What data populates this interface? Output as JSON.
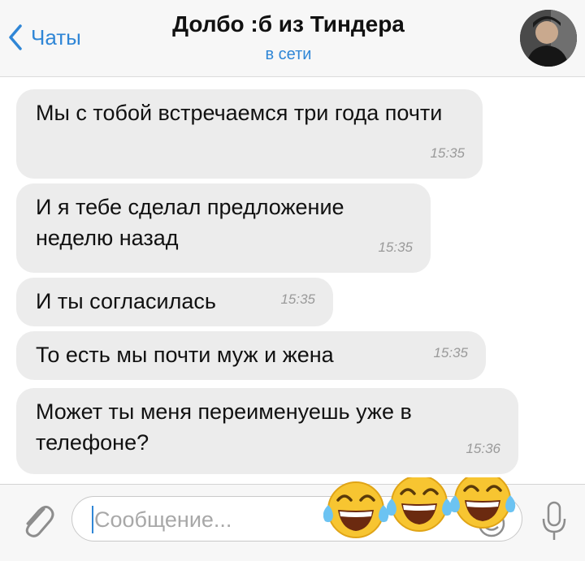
{
  "header": {
    "back_label": "Чаты",
    "title": "Долбо :б из Тиндера",
    "status": "в сети"
  },
  "messages": [
    {
      "text": "Мы с тобой встречаемся три года почти",
      "time": "15:35"
    },
    {
      "text": "И я тебе сделал предложение неделю назад",
      "time": "15:35"
    },
    {
      "text": "И ты согласилась",
      "time": "15:35"
    },
    {
      "text": "То есть мы почти муж и жена",
      "time": "15:35"
    },
    {
      "text": "Может ты меня переименуешь уже в телефоне?",
      "time": "15:36"
    }
  ],
  "input": {
    "placeholder": "Сообщение..."
  },
  "icons": {
    "back": "chevron-left-icon",
    "attach": "paperclip-icon",
    "mic": "microphone-icon",
    "sticker": "sticker-icon",
    "overlay": "tears-of-joy-emoji"
  },
  "colors": {
    "accent": "#2f86d6",
    "bubble": "#ececec",
    "header_bg": "#f7f7f7"
  }
}
